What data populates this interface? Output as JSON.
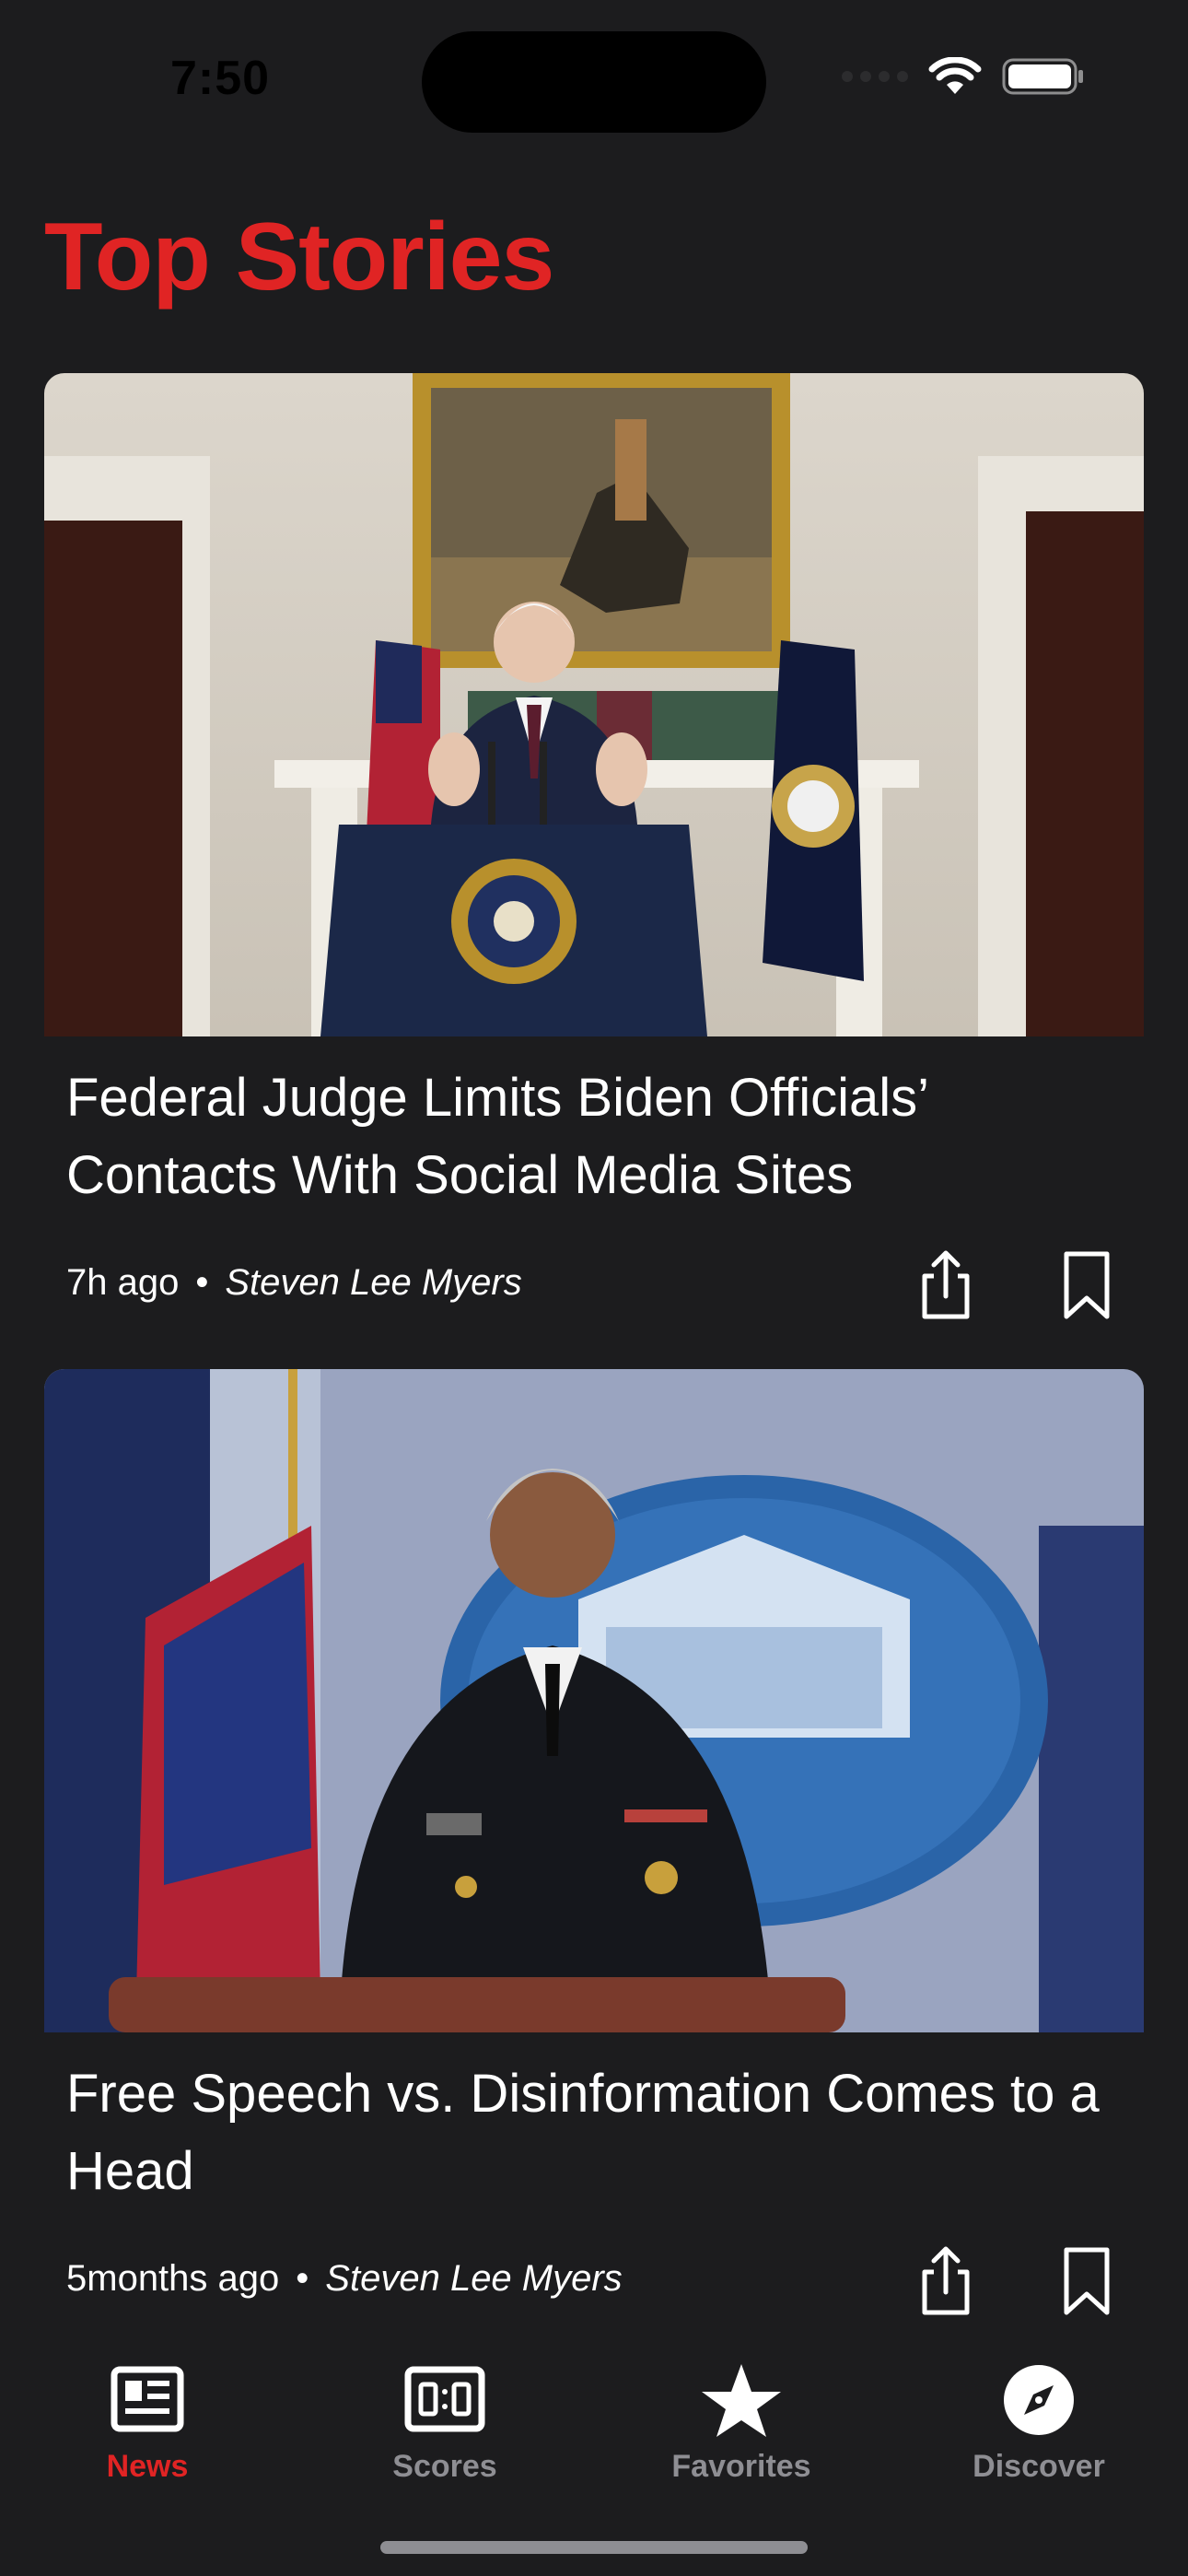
{
  "status_bar": {
    "time": "7:50"
  },
  "page": {
    "title": "Top Stories"
  },
  "articles": [
    {
      "headline": "Federal Judge Limits Biden Officials’ Contacts With Social Media Sites",
      "time_ago": "7h ago",
      "separator": "•",
      "author": "Steven Lee Myers"
    },
    {
      "headline": "Free Speech vs. Disinformation Comes to a Head",
      "time_ago": "5months ago",
      "separator": "•",
      "author": "Steven Lee Myers"
    }
  ],
  "tabs": [
    {
      "label": "News",
      "icon": "newspaper-icon",
      "active": true
    },
    {
      "label": "Scores",
      "icon": "scoreboard-icon",
      "active": false
    },
    {
      "label": "Favorites",
      "icon": "star-icon",
      "active": false
    },
    {
      "label": "Discover",
      "icon": "compass-icon",
      "active": false
    }
  ],
  "colors": {
    "accent": "#e02424",
    "background": "#1c1c1e",
    "inactive_tab": "#8e8e93"
  }
}
